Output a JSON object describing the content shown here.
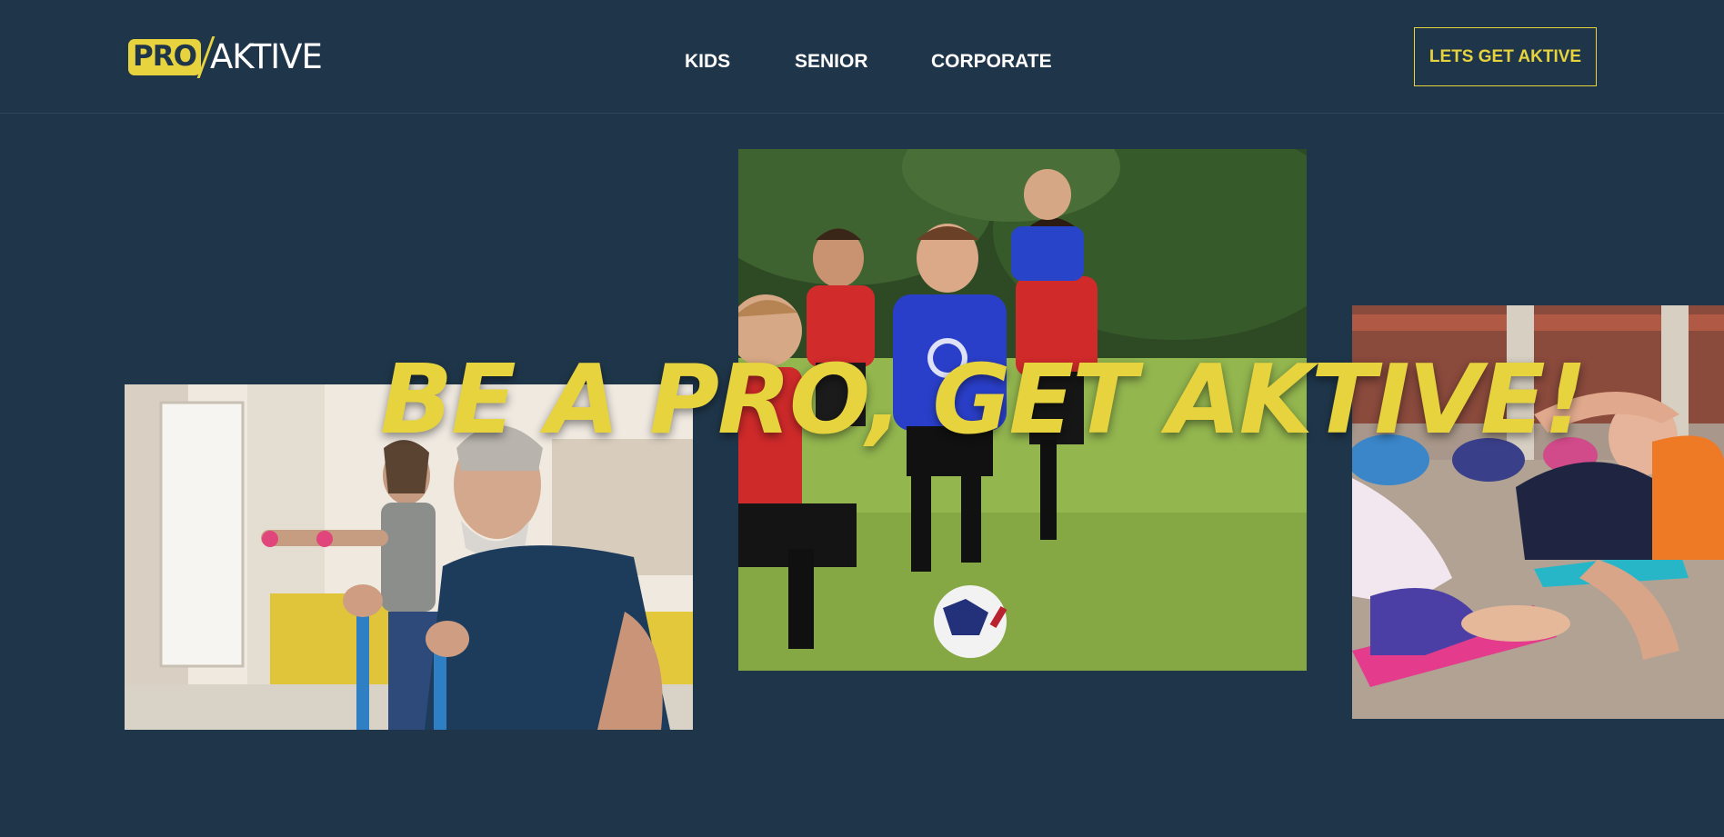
{
  "brand": {
    "logo_pro": "PRO",
    "logo_aktive": "AKTIVE",
    "accent_color": "#e7d33e",
    "background_color": "#1f364a"
  },
  "nav": {
    "items": [
      {
        "label": "KIDS"
      },
      {
        "label": "SENIOR"
      },
      {
        "label": "CORPORATE"
      }
    ]
  },
  "cta": {
    "label": "LETS GET AKTIVE"
  },
  "hero": {
    "headline": "BE A PRO, GET AKTIVE!",
    "images": [
      {
        "subject": "senior-exercise-photo"
      },
      {
        "subject": "kids-soccer-photo"
      },
      {
        "subject": "group-yoga-photo"
      }
    ]
  }
}
